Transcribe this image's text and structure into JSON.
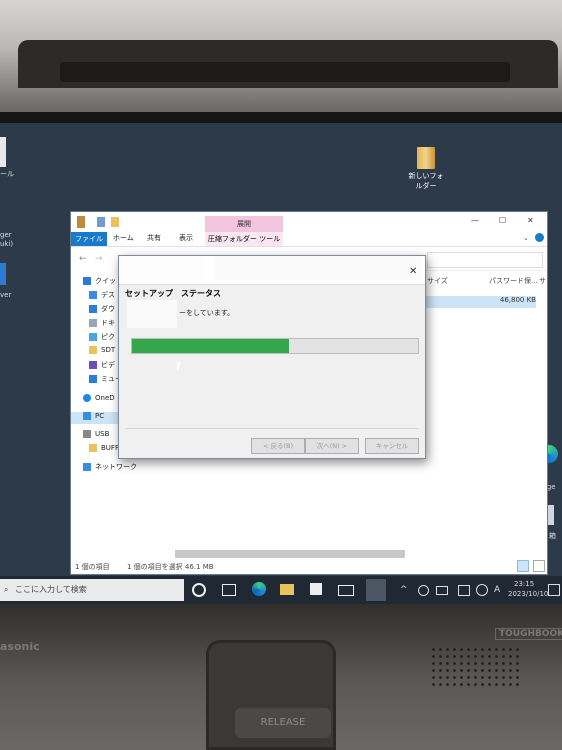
{
  "desktop": {
    "new_folder_label": "新しいフォルダー",
    "left_fragments": [
      "ール",
      "ger",
      "uki)",
      "ver"
    ],
    "edge_label": "oft Edge",
    "right_icon_label": "ミ箱"
  },
  "explorer": {
    "ribbon_tabs": [
      "ファイル",
      "ホーム",
      "共有",
      "表示"
    ],
    "context_tab_group": "展開",
    "context_tab": "圧縮フォルダー ツール",
    "window_controls": [
      "—",
      "☐",
      "✕"
    ],
    "nav_items": [
      "クイッ",
      "デス",
      "ダウ",
      "ドキ",
      "ピク",
      "SDT",
      "ビデ",
      "ミュー",
      "OneD",
      "PC",
      "USB",
      "BUFFALO",
      "ネットワーク"
    ],
    "column_headers": [
      "サイズ",
      "パスワード保...",
      "サ"
    ],
    "selected_size": "46,800 KB",
    "status_left": "1 個の項目",
    "status_right": "1 個の項目を選択 46.1 MB"
  },
  "dialog": {
    "title": "セットアップ　ステータス",
    "status_text": "ーをしています。",
    "progress_fraction": 0.55,
    "buttons": {
      "back": "< 戻る(B)",
      "next": "次へ(N) >",
      "cancel": "キャンセル"
    },
    "close_glyph": "✕"
  },
  "taskbar": {
    "search_placeholder": "ここに入力して検索",
    "time": "23:15",
    "date": "2023/10/10",
    "tray_chevron": "^",
    "tray_ime": "A"
  },
  "hardware": {
    "brand_left": "asonic",
    "brand_right": "TOUGHBOOK",
    "latch_label": "RELEASE"
  },
  "colors": {
    "progress": "#35a64b",
    "ribbon_file": "#1979ca",
    "context_tab": "#f3c4dd"
  }
}
